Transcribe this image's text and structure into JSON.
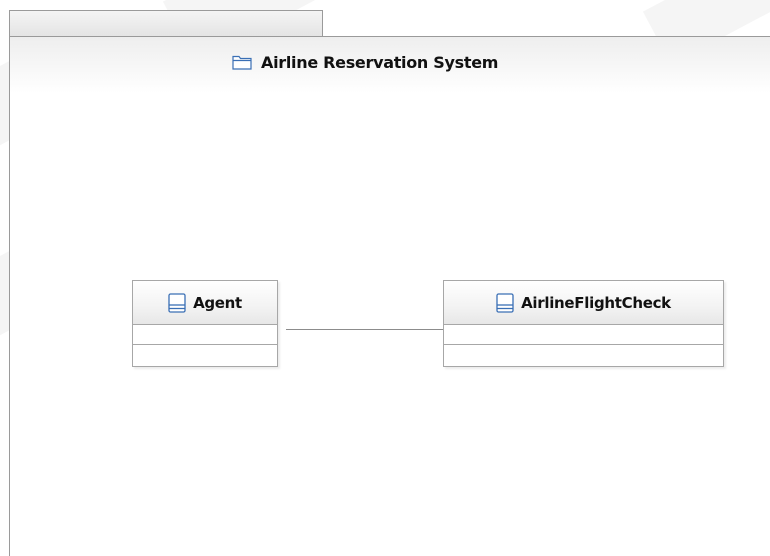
{
  "diagram": {
    "package": {
      "title": "Airline Reservation System",
      "icon": "folder-icon"
    },
    "classes": [
      {
        "name": "Agent",
        "icon": "class-icon"
      },
      {
        "name": "AirlineFlightCheck",
        "icon": "class-icon"
      }
    ],
    "association": {
      "from": "Agent",
      "to": "AirlineFlightCheck"
    }
  },
  "colors": {
    "icon_blue": "#3a6fb5",
    "border": "#a7a7a7",
    "line": "#8c8c8c"
  }
}
